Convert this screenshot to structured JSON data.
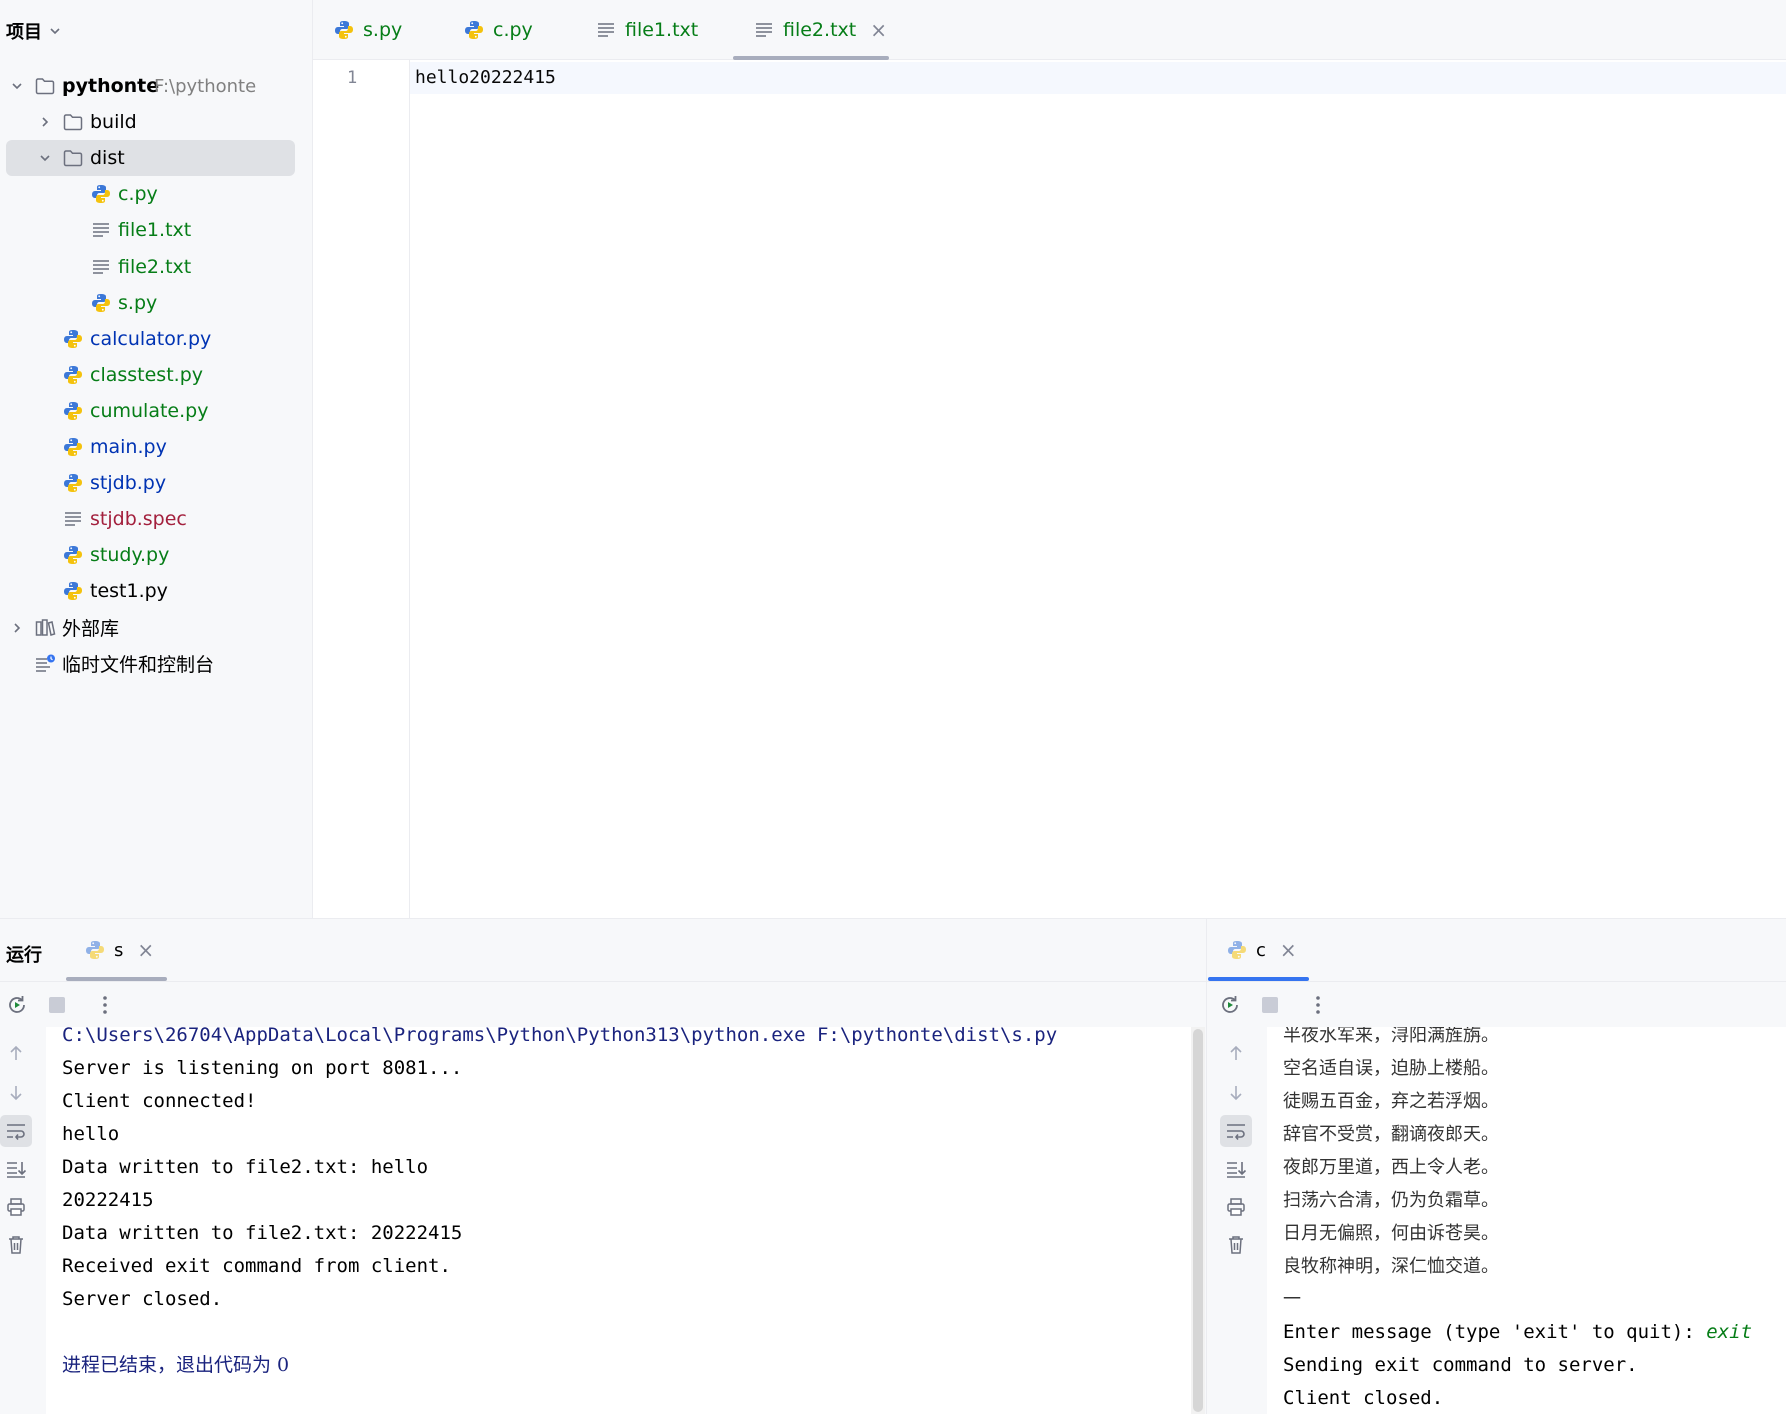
{
  "sidebar": {
    "title": "项目",
    "tree": [
      {
        "label": "pythonte",
        "path": "F:\\pythonte",
        "type": "folder",
        "expanded": true,
        "color": "black",
        "level": 0
      },
      {
        "label": "build",
        "type": "folder",
        "expanded": false,
        "color": "black",
        "level": 1
      },
      {
        "label": "dist",
        "type": "folder",
        "expanded": true,
        "color": "black",
        "level": 1,
        "selected": true
      },
      {
        "label": "c.py",
        "type": "python",
        "color": "green",
        "level": 2
      },
      {
        "label": "file1.txt",
        "type": "text",
        "color": "green",
        "level": 2
      },
      {
        "label": "file2.txt",
        "type": "text",
        "color": "green",
        "level": 2
      },
      {
        "label": "s.py",
        "type": "python",
        "color": "green",
        "level": 2
      },
      {
        "label": "calculator.py",
        "type": "python",
        "color": "blue",
        "level": 1
      },
      {
        "label": "classtest.py",
        "type": "python",
        "color": "green",
        "level": 1
      },
      {
        "label": "cumulate.py",
        "type": "python",
        "color": "green",
        "level": 1
      },
      {
        "label": "main.py",
        "type": "python",
        "color": "blue",
        "level": 1
      },
      {
        "label": "stjdb.py",
        "type": "python",
        "color": "blue",
        "level": 1
      },
      {
        "label": "stjdb.spec",
        "type": "text",
        "color": "red",
        "level": 1
      },
      {
        "label": "study.py",
        "type": "python",
        "color": "green",
        "level": 1
      },
      {
        "label": "test1.py",
        "type": "python",
        "color": "black",
        "level": 1
      },
      {
        "label": "外部库",
        "type": "library",
        "expanded": false,
        "color": "black",
        "level": 0
      },
      {
        "label": "临时文件和控制台",
        "type": "scratch",
        "color": "black",
        "level": 0
      }
    ]
  },
  "editor": {
    "tabs": [
      {
        "label": "s.py",
        "type": "python",
        "color": "green",
        "active": false
      },
      {
        "label": "c.py",
        "type": "python",
        "color": "green",
        "active": false
      },
      {
        "label": "file1.txt",
        "type": "text",
        "color": "green",
        "active": false
      },
      {
        "label": "file2.txt",
        "type": "text",
        "color": "green",
        "active": true,
        "close": "×"
      }
    ],
    "line_number": "1",
    "content": "hello20222415"
  },
  "run": {
    "title": "运行",
    "left": {
      "tab": "s",
      "close": "×",
      "lines": [
        {
          "text": "C:\\Users\\26704\\AppData\\Local\\Programs\\Python\\Python313\\python.exe F:\\pythonte\\dist\\s.py",
          "kind": "cmd"
        },
        {
          "text": "Server is listening on port 8081...",
          "kind": "out"
        },
        {
          "text": "Client connected!",
          "kind": "out"
        },
        {
          "text": "hello",
          "kind": "out"
        },
        {
          "text": "Data written to file2.txt: hello",
          "kind": "out"
        },
        {
          "text": "20222415",
          "kind": "out"
        },
        {
          "text": "Data written to file2.txt: 20222415",
          "kind": "out"
        },
        {
          "text": "Received exit command from client.",
          "kind": "out"
        },
        {
          "text": "Server closed.",
          "kind": "out"
        },
        {
          "text": "",
          "kind": "out"
        },
        {
          "text": "进程已结束，退出代码为 0",
          "kind": "info"
        }
      ]
    },
    "right": {
      "tab": "c",
      "close": "×",
      "lines": [
        {
          "text": "半夜水军来，浔阳满旌旃。",
          "kind": "poem"
        },
        {
          "text": "空名适自误，迫胁上楼船。",
          "kind": "poem"
        },
        {
          "text": "徒赐五百金，弃之若浮烟。",
          "kind": "poem"
        },
        {
          "text": "辞官不受赏，翻谪夜郎天。",
          "kind": "poem"
        },
        {
          "text": "夜郎万里道，西上令人老。",
          "kind": "poem"
        },
        {
          "text": "扫荡六合清，仍为负霜草。",
          "kind": "poem"
        },
        {
          "text": "日月无偏照，何由诉苍昊。",
          "kind": "poem"
        },
        {
          "text": "良牧称神明，深仁恤交道。",
          "kind": "poem"
        },
        {
          "text": "一",
          "kind": "poem"
        },
        {
          "text": "Enter message (type 'exit' to quit): ",
          "kind": "out",
          "user_input": "exit"
        },
        {
          "text": "Sending exit command to server.",
          "kind": "out"
        },
        {
          "text": "Client closed.",
          "kind": "out"
        }
      ]
    }
  },
  "colors": {
    "green": "#067d17",
    "blue": "#0033b3",
    "red": "#a3203d",
    "black": "#000000",
    "active_tab_underline": "#3574f0"
  }
}
